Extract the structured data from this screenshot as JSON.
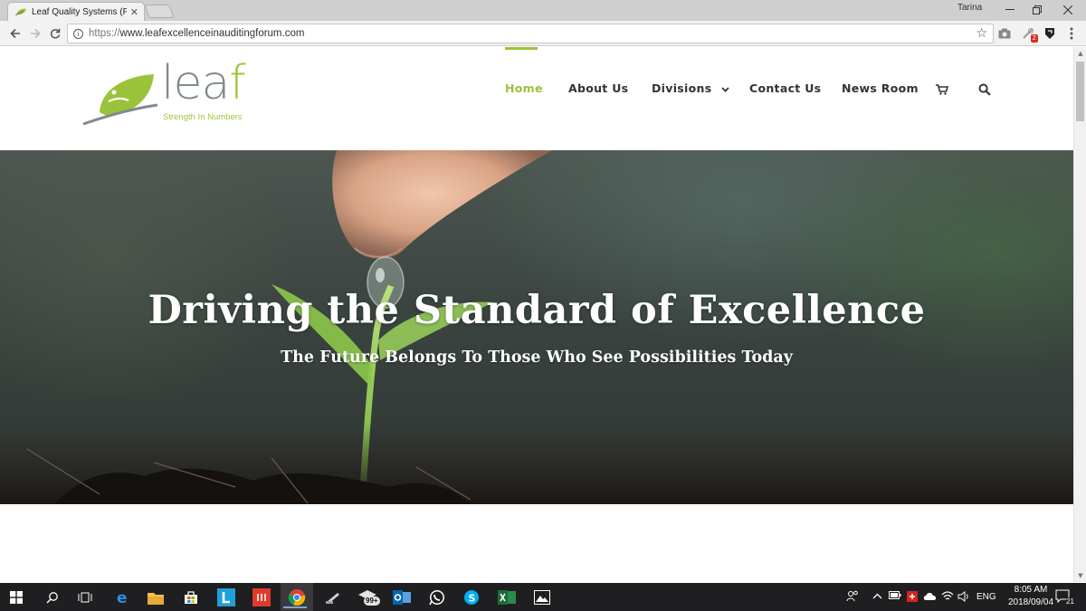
{
  "browser": {
    "tab_title": "Leaf Quality Systems (Pty",
    "profile_name": "Tarina",
    "url_scheme": "https://",
    "url_host": "www.leafexcellenceinauditingforum.com",
    "extension_badge": "2"
  },
  "site": {
    "logo_word_main": "lea",
    "logo_word_f": "f",
    "logo_tagline": "Strength In Numbers",
    "nav": [
      {
        "label": "Home",
        "active": true
      },
      {
        "label": "About Us",
        "active": false
      },
      {
        "label": "Divisions",
        "active": false
      },
      {
        "label": "Contact Us",
        "active": false
      },
      {
        "label": "News Room",
        "active": false
      }
    ],
    "accent_color": "#9bc23b"
  },
  "hero": {
    "title": "Driving the Standard of Excellence",
    "subtitle": "The Future Belongs To Those Who See Possibilities Today"
  },
  "taskbar": {
    "notification_count": "99+",
    "language": "ENG",
    "time": "8:05 AM",
    "date": "2018/09/04",
    "action_center_count": "21"
  }
}
